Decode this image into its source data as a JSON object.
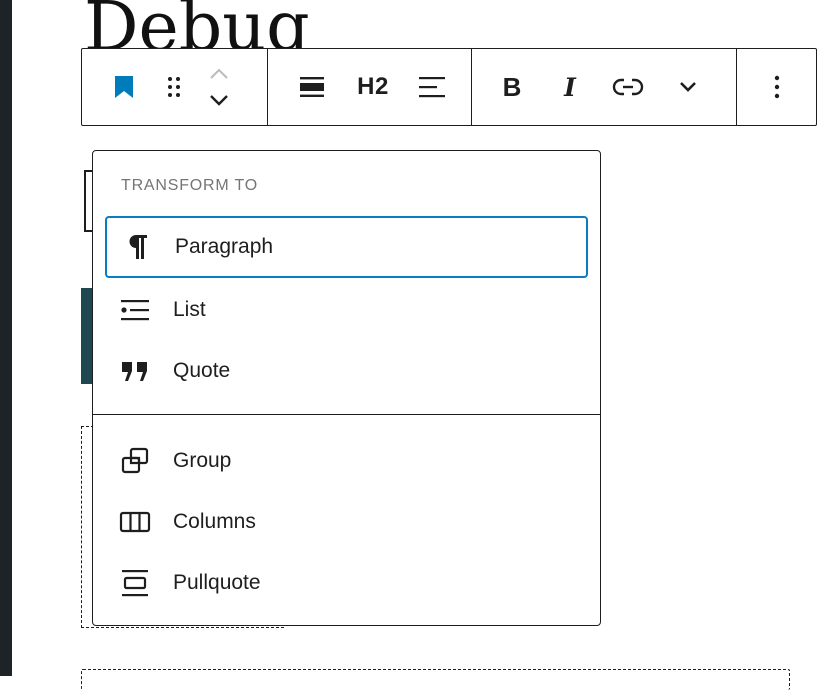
{
  "editor": {
    "heading_text": "Debug"
  },
  "toolbar": {
    "h2_label": "H2",
    "bold_label": "B",
    "italic_label": "I"
  },
  "transform_menu": {
    "header": "TRANSFORM TO",
    "items": [
      {
        "label": "Paragraph",
        "icon": "paragraph-icon"
      },
      {
        "label": "List",
        "icon": "list-icon"
      },
      {
        "label": "Quote",
        "icon": "quote-icon"
      },
      {
        "label": "Group",
        "icon": "group-icon"
      },
      {
        "label": "Columns",
        "icon": "columns-icon"
      },
      {
        "label": "Pullquote",
        "icon": "pullquote-icon"
      }
    ]
  },
  "colors": {
    "accent": "#0a7dbe",
    "bookmark": "#007cba",
    "border": "#1e1e1e",
    "muted": "#757575"
  }
}
